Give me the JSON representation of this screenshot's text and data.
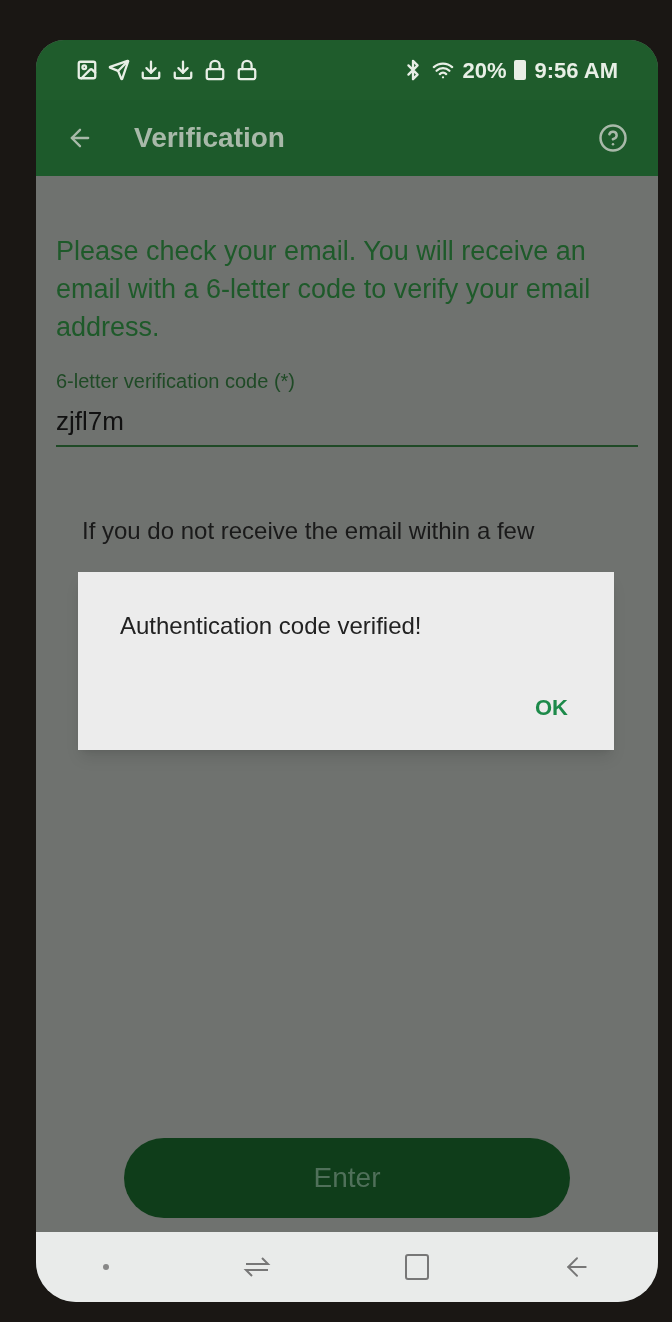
{
  "status_bar": {
    "battery": "20%",
    "time": "9:56 AM"
  },
  "header": {
    "title": "Verification"
  },
  "instructions": "Please check your email. You will receive an email with a 6-letter code to verify your email address.",
  "code_field": {
    "label": "6-letter verification code (*)",
    "value": "zjfl7m"
  },
  "resend_note": "If you do not receive the email within a few",
  "dialog": {
    "message": "Authentication code verified!",
    "button": "OK"
  },
  "enter_button": {
    "label": "Enter"
  }
}
